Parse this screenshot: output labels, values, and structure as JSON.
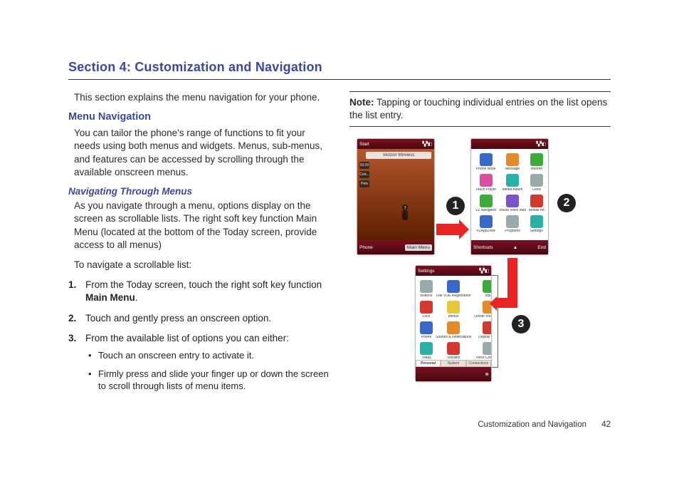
{
  "title": "Section 4: Customization and Navigation",
  "intro": "This section explains the menu navigation for your phone.",
  "h2": "Menu Navigation",
  "p1": "You can tailor the phone's range of functions to fit your needs using both menus and widgets. Menus, sub-menus, and features can be accessed by scrolling through the available onscreen menus.",
  "h3": "Navigating Through Menus",
  "p2": "As you navigate through a menu, options display on the screen as scrollable lists. The right soft key function Main Menu (located at the bottom of the Today screen, provide access to all menus)",
  "p3": "To navigate a scrollable list:",
  "steps": [
    {
      "pre": "From the Today screen, touch the right soft key function ",
      "strong": "Main Menu",
      "post": "."
    },
    {
      "text": "Touch and gently press an onscreen option."
    },
    {
      "text": "From the available list of options you can either:"
    }
  ],
  "bullets": [
    "Touch an onscreen entry to activate it.",
    "Firmly press and slide your finger up or down the screen to scroll through lists of menu items."
  ],
  "note": {
    "label": "Note:",
    "text": " Tapping or touching individual entries on the list opens the list entry."
  },
  "footer": {
    "section": "Customization and Navigation",
    "page": "42"
  },
  "phone1": {
    "title": "Start",
    "carrier": "Verizon Wireless",
    "chips": [
      "03:20",
      "Cort...",
      "Pets"
    ],
    "softLeft": "Phone",
    "softRight": "Main Menu"
  },
  "phone2": {
    "apps": [
      {
        "c": "c-blue",
        "l": "Phone Book"
      },
      {
        "c": "c-orange",
        "l": "Message"
      },
      {
        "c": "c-green",
        "l": "Internet"
      },
      {
        "c": "c-pink",
        "l": "Touch Player"
      },
      {
        "c": "c-teal",
        "l": "Media Album"
      },
      {
        "c": "c-gray",
        "l": "Clock"
      },
      {
        "c": "c-green",
        "l": "VZ Navigator"
      },
      {
        "c": "c-purple",
        "l": "Visual Voice Mail"
      },
      {
        "c": "c-red",
        "l": "Mobile IM"
      },
      {
        "c": "c-blue",
        "l": "VZAppZone"
      },
      {
        "c": "c-gray",
        "l": "Programs"
      },
      {
        "c": "c-teal",
        "l": "Settings"
      }
    ],
    "softLeft": "Shortcuts",
    "softRight": "End"
  },
  "phone3": {
    "title": "Settings",
    "apps": [
      {
        "c": "c-gray",
        "l": "Buttons"
      },
      {
        "c": "c-blue",
        "l": "Dial VOE Registration"
      },
      {
        "c": "c-green",
        "l": "Input"
      },
      {
        "c": "c-red",
        "l": "Lock"
      },
      {
        "c": "c-yellow",
        "l": "Menus"
      },
      {
        "c": "c-orange",
        "l": "Owner Information"
      },
      {
        "c": "c-blue",
        "l": "Phone"
      },
      {
        "c": "c-orange",
        "l": "Sounds & Notifications"
      },
      {
        "c": "c-red",
        "l": "Display Prefs"
      },
      {
        "c": "c-teal",
        "l": "Today"
      },
      {
        "c": "c-red",
        "l": "Vibrates"
      },
      {
        "c": "c-gray",
        "l": "Voice Command"
      }
    ],
    "tabs": [
      "Personal",
      "System",
      "Connections"
    ]
  },
  "callouts": {
    "1": "1",
    "2": "2",
    "3": "3"
  }
}
